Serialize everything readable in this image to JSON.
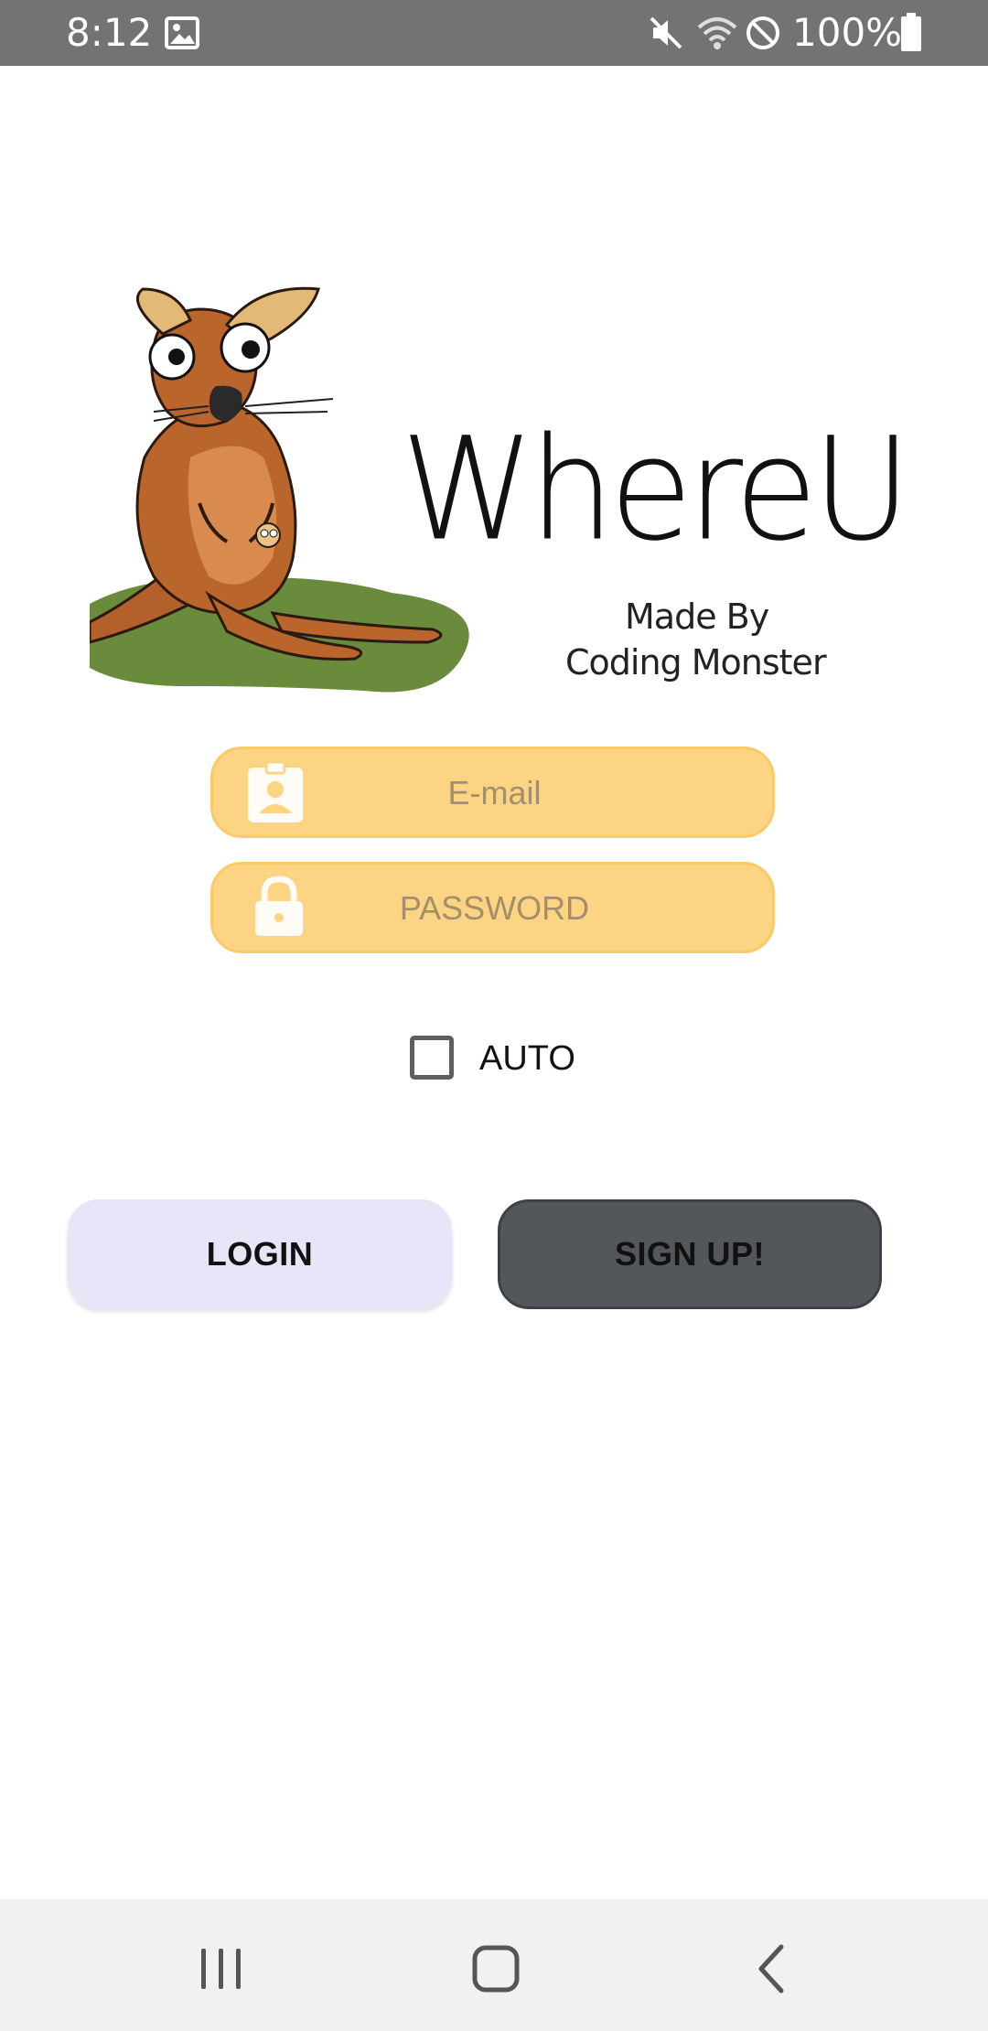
{
  "status_bar": {
    "time": "8:12",
    "battery": "100%",
    "icons": [
      "image-icon",
      "mute-icon",
      "wifi-icon",
      "no-sim-icon",
      "battery-icon"
    ]
  },
  "logo": {
    "title": "WhereU",
    "subtitle_line1": "Made By",
    "subtitle_line2": "Coding Monster"
  },
  "login_form": {
    "email_placeholder": "E-mail",
    "email_value": "",
    "password_placeholder": "PASSWORD",
    "password_value": "",
    "auto_label": "AUTO",
    "auto_checked": false,
    "login_label": "LOGIN",
    "signup_label": "SIGN UP!"
  },
  "colors": {
    "status_bar": "#737373",
    "field_bg": "#fdd483",
    "login_bg": "#e6e6f8",
    "signup_bg": "#53565b",
    "nav_bar": "#f1f1f1"
  },
  "nav_bar": {
    "icons": [
      "recents-icon",
      "home-icon",
      "back-icon"
    ]
  }
}
